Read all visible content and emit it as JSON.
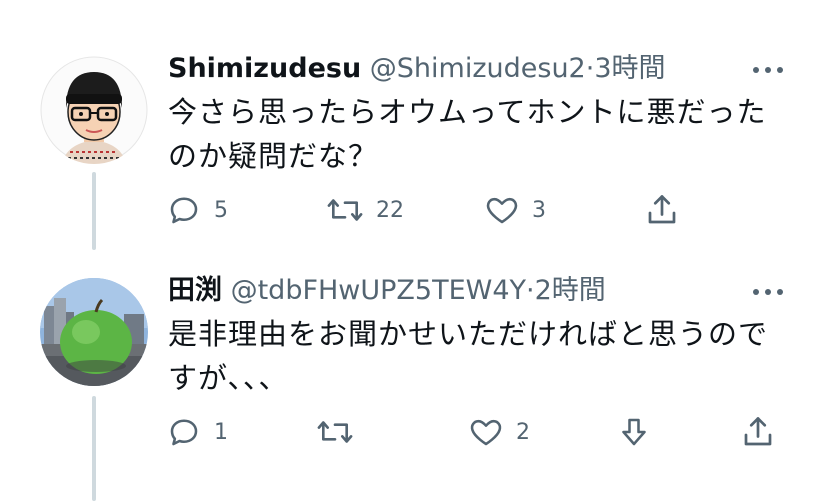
{
  "tweets": [
    {
      "display_name": "Shimizudesu",
      "handle": "@Shimizudesu2",
      "separator": "·",
      "time": "3時間",
      "text_line1": "今さら思ったらオウムってホントに悪だった",
      "text_line2": "のか疑問だな？",
      "replies": "5",
      "retweets": "22",
      "likes": "3",
      "avatar_icon": "cartoon-man-avatar-icon"
    },
    {
      "display_name": "田渕",
      "handle": "@tdbFHwUPZ5TEW4Y",
      "separator": "·",
      "time": "2時間",
      "text_line1": "是非理由をお聞かせいただければと思うので",
      "text_line2": "すが、、、",
      "replies": "1",
      "retweets": "",
      "likes": "2",
      "avatar_icon": "green-apple-sculpture-avatar-icon"
    }
  ],
  "colors": {
    "text_primary": "#0f1419",
    "text_secondary": "#536471",
    "thread_line": "#cfd9de"
  }
}
